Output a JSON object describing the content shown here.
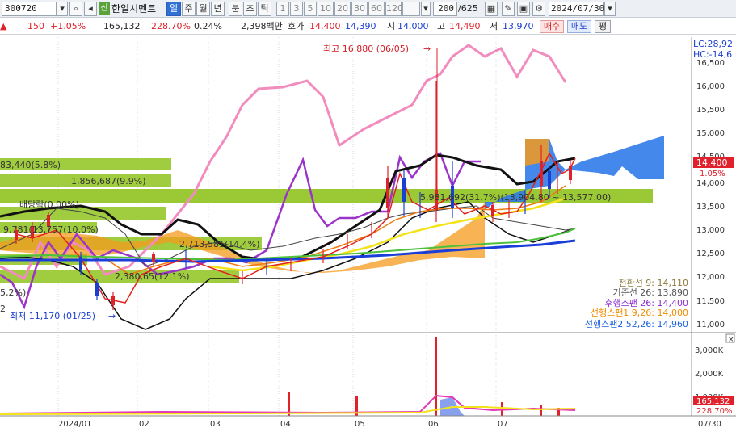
{
  "toolbar": {
    "code": "300720",
    "badge": "신",
    "name": "한일시멘트",
    "period_tabs": [
      "일",
      "주",
      "월",
      "년",
      "분",
      "초",
      "틱"
    ],
    "selected_period": "일",
    "minute_options": [
      "1",
      "3",
      "5",
      "10",
      "20",
      "30",
      "60",
      "120"
    ],
    "count": "200",
    "total": "/625",
    "date": "2024/07/30"
  },
  "quote": {
    "change_abs": "150",
    "change_pct": "+1.05%",
    "volume": "165,132",
    "volume_ratio": "228.70%",
    "turnover": "0.24%",
    "amount": "2,398백만",
    "ask_label": "호가",
    "ask": "14,400",
    "bid": "14,390",
    "open_label": "시",
    "open": "14,000",
    "high_label": "고",
    "high": "14,490",
    "low_label": "저",
    "low": "13,970",
    "buy_label": "매수",
    "sell_label": "매도",
    "flat_label": "평"
  },
  "chart_data": {
    "type": "candlestick",
    "price_axis": [
      "16,500",
      "16,000",
      "15,500",
      "15,000",
      "14,500",
      "14,000",
      "13,500",
      "13,000",
      "12,500",
      "12,000",
      "11,500",
      "11,000"
    ],
    "volume_axis": [
      "3,000K",
      "2,000K",
      "1,000K"
    ],
    "x_labels": [
      "2024/01",
      "02",
      "03",
      "04",
      "05",
      "06",
      "07"
    ],
    "x_end": "07/30",
    "current_price": "14,400",
    "current_pct": "1.05%",
    "current_volume": "165,132",
    "volume_pct": "228,70%",
    "top_right_1": "LC:28,92",
    "top_right_2": "HC:-14,6",
    "high_note": "최고 16,880 (06/05)",
    "low_note": "최저 11,170 (01/25)",
    "dividend_note": "배당락(0.00%)",
    "volume_profile": [
      "83,440(5.8%)",
      "1,856,687(9.9%)",
      "9,781(13,757(10.0%)",
      "2,713,581(14.4%)",
      "2,380,65(12.1%)",
      "5,2%)",
      "2"
    ],
    "range_note": "5,981,692(31.7%)(13,904.80 ~ 13,577.00)",
    "ichimoku": [
      {
        "name": "전환선",
        "period": "9",
        "value": "14,110",
        "color": "#8a7a3a"
      },
      {
        "name": "기준선",
        "period": "26",
        "value": "13,890",
        "color": "#555555"
      },
      {
        "name": "후행스팬",
        "period": "26",
        "value": "14,400",
        "color": "#8a2ad0"
      },
      {
        "name": "선행스팬1",
        "period": "9,26",
        "value": "14,000",
        "color": "#f08a00"
      },
      {
        "name": "선행스팬2",
        "period": "52,26",
        "value": "14,960",
        "color": "#1b5fe0"
      }
    ]
  }
}
